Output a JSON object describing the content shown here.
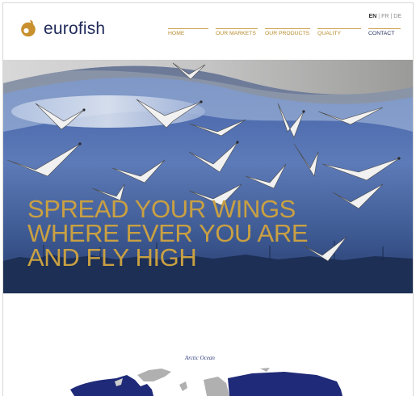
{
  "brand": {
    "name": "eurofish",
    "colors": {
      "navy": "#1f2a5a",
      "gold": "#c9a042",
      "orange": "#c8902e"
    }
  },
  "languages": [
    {
      "code": "EN",
      "active": true
    },
    {
      "code": "FR",
      "active": false
    },
    {
      "code": "DE",
      "active": false
    }
  ],
  "nav": {
    "items": [
      {
        "label": "HOME",
        "active": false
      },
      {
        "label": "OUR MARKETS",
        "active": false
      },
      {
        "label": "OUR PRODUCTS",
        "active": false
      },
      {
        "label": "QUALITY",
        "active": false
      },
      {
        "label": "CONTACT",
        "active": true
      }
    ]
  },
  "hero": {
    "headline": [
      "SPREAD YOUR WINGS",
      "WHERE EVER YOU ARE",
      "AND FLY HIGH"
    ]
  },
  "map": {
    "label": "Arctic Ocean"
  },
  "icons": {
    "logo": "eurofish-logo-icon"
  }
}
